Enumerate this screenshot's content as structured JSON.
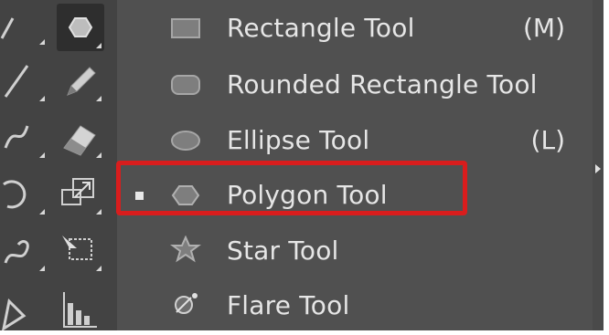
{
  "menu": {
    "items": [
      {
        "label": "Rectangle Tool",
        "shortcut": "(M)",
        "icon": "rectangle-icon",
        "selected": false
      },
      {
        "label": "Rounded Rectangle Tool",
        "shortcut": "",
        "icon": "rounded-rectangle-icon",
        "selected": false
      },
      {
        "label": "Ellipse Tool",
        "shortcut": "(L)",
        "icon": "ellipse-icon",
        "selected": false
      },
      {
        "label": "Polygon Tool",
        "shortcut": "",
        "icon": "polygon-icon",
        "selected": true
      },
      {
        "label": "Star Tool",
        "shortcut": "",
        "icon": "star-icon",
        "selected": false
      },
      {
        "label": "Flare Tool",
        "shortcut": "",
        "icon": "flare-icon",
        "selected": false
      }
    ]
  },
  "toolbar": {
    "tools": [
      "selection-icon",
      "polygon-icon",
      "line-segment-icon",
      "pencil-icon",
      "shaper-icon",
      "eraser-icon",
      "rotate-icon",
      "scale-icon",
      "warp-icon",
      "free-transform-icon",
      "perspective-grid-icon",
      "graph-icon"
    ]
  },
  "colors": {
    "panel": "#505050",
    "toolbar": "#434343",
    "text": "#e6e6e6",
    "highlight": "#d91d1d"
  }
}
